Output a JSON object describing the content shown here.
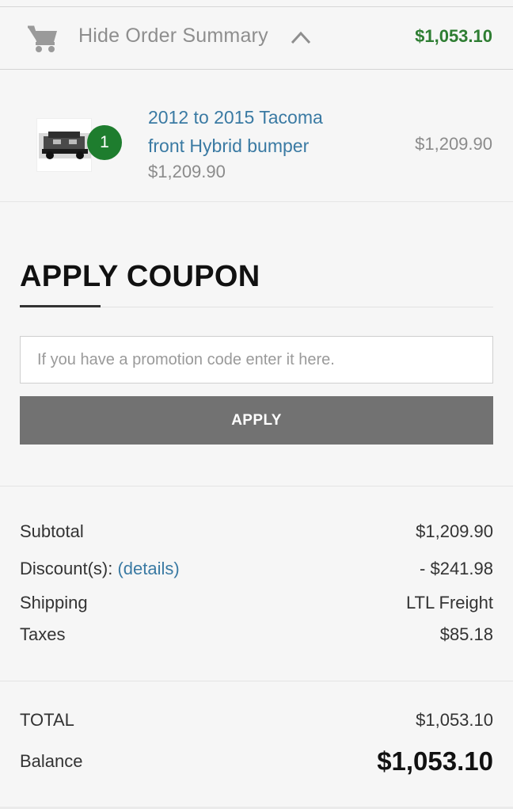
{
  "header": {
    "toggle_label": "Hide Order Summary",
    "total": "$1,053.10",
    "total_color": "#2e7d32"
  },
  "item": {
    "quantity": "1",
    "name": "2012 to 2015 Tacoma front Hybrid bumper",
    "unit_price": "$1,209.90",
    "line_total": "$1,209.90"
  },
  "coupon": {
    "title": "APPLY COUPON",
    "placeholder": "If you have a promotion code enter it here.",
    "value": "",
    "apply_label": "APPLY"
  },
  "totals": {
    "subtotal_label": "Subtotal",
    "subtotal": "$1,209.90",
    "discount_label": "Discount(s):",
    "discount_link": "(details)",
    "discount": "- $241.98",
    "shipping_label": "Shipping",
    "shipping": "LTL Freight",
    "taxes_label": "Taxes",
    "taxes": "$85.18",
    "total_label": "TOTAL",
    "total": "$1,053.10",
    "balance_label": "Balance",
    "balance": "$1,053.10"
  },
  "icons": {
    "cart": "shopping-cart-icon",
    "chevron": "chevron-up-icon"
  }
}
